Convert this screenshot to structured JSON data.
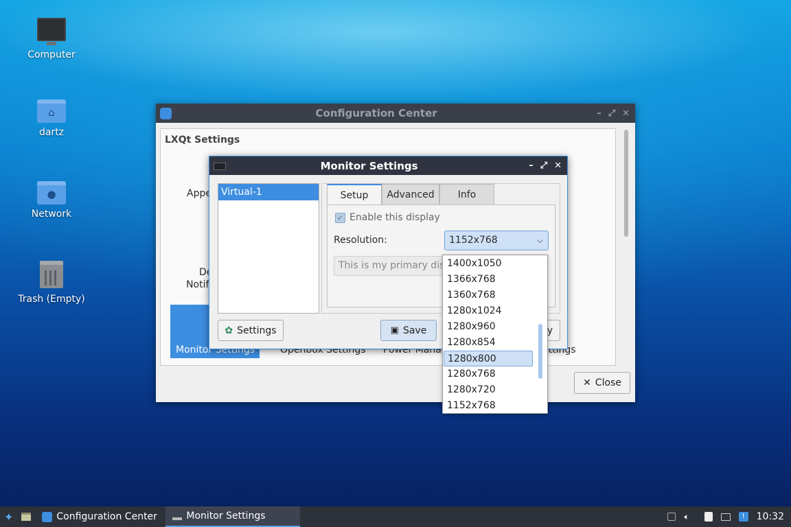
{
  "desktop": {
    "icons": [
      {
        "label": "Computer",
        "icon": "computer-icon"
      },
      {
        "label": "dartz",
        "icon": "home-folder-icon"
      },
      {
        "label": "Network",
        "icon": "network-folder-icon"
      },
      {
        "label": "Trash (Empty)",
        "icon": "trash-icon"
      }
    ]
  },
  "config_center": {
    "title": "Configuration Center",
    "group_title": "LXQt Settings",
    "items": [
      "Appe",
      "De",
      "Notifi",
      "Monitor Settings",
      "Openbox Settings",
      "Power Mana",
      "ettings"
    ],
    "close_label": "Close"
  },
  "monitor_settings": {
    "title": "Monitor Settings",
    "monitors": [
      "Virtual-1"
    ],
    "tabs": [
      "Setup",
      "Advanced",
      "Info"
    ],
    "enable_label": "Enable this display",
    "resolution_label": "Resolution:",
    "resolution_value": "1152x768",
    "primary_label": "This is my primary disp",
    "settings_label": "Settings",
    "save_label": "Save",
    "apply_partial": "y"
  },
  "resolution_options": [
    "1400x1050",
    "1366x768",
    "1360x768",
    "1280x1024",
    "1280x960",
    "1280x854",
    "1280x800",
    "1280x768",
    "1280x720",
    "1152x768"
  ],
  "resolution_highlighted": "1280x800",
  "taskbar": {
    "tasks": [
      "Configuration Center",
      "Monitor Settings"
    ],
    "clock": "10:32"
  },
  "colors": {
    "accent": "#3d8ee0",
    "selection": "#3d8ee0",
    "titlebar": "#2f3440"
  }
}
